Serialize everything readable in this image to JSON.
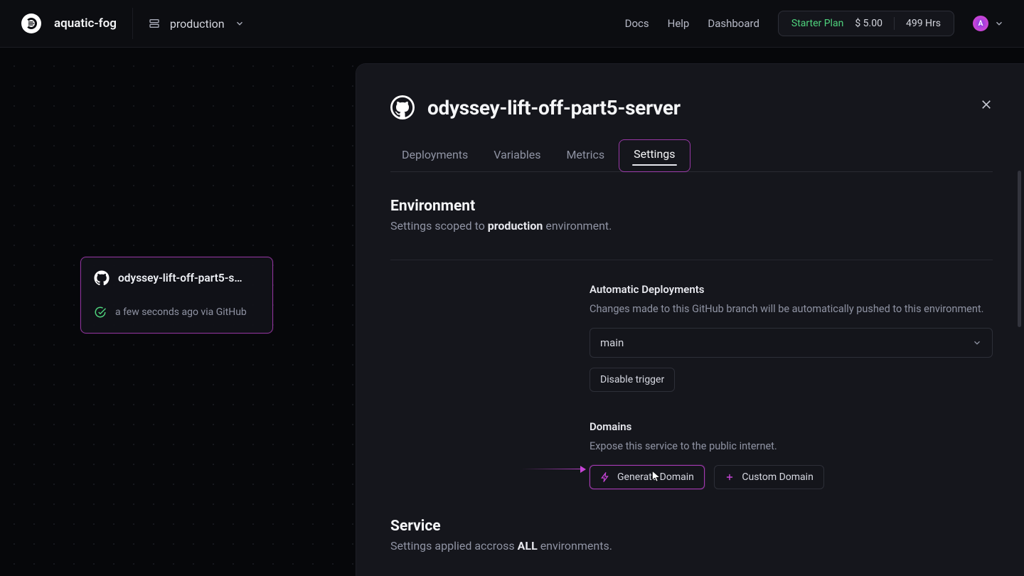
{
  "header": {
    "project_name": "aquatic-fog",
    "environment": "production",
    "nav": {
      "docs": "Docs",
      "help": "Help",
      "dashboard": "Dashboard"
    },
    "plan": {
      "name": "Starter Plan",
      "price": "$ 5.00",
      "hours": "499 Hrs"
    },
    "avatar_letter": "A"
  },
  "service_card": {
    "name": "odyssey-lift-off-part5-s…",
    "status_text": "a few seconds ago via GitHub"
  },
  "panel": {
    "title": "odyssey-lift-off-part5-server",
    "tabs": {
      "deployments": "Deployments",
      "variables": "Variables",
      "metrics": "Metrics",
      "settings": "Settings"
    },
    "env_section": {
      "title": "Environment",
      "sub_prefix": "Settings scoped to ",
      "sub_bold": "production",
      "sub_suffix": " environment."
    },
    "auto_deploy": {
      "title": "Automatic Deployments",
      "desc": "Changes made to this GitHub branch will be automatically pushed to this environment.",
      "branch": "main",
      "disable": "Disable trigger"
    },
    "domains": {
      "title": "Domains",
      "desc": "Expose this service to the public internet.",
      "generate": "Generate Domain",
      "custom": "Custom Domain"
    },
    "service_section": {
      "title": "Service",
      "sub_prefix": "Settings applied accross ",
      "sub_bold": "ALL",
      "sub_suffix": " environments."
    }
  }
}
